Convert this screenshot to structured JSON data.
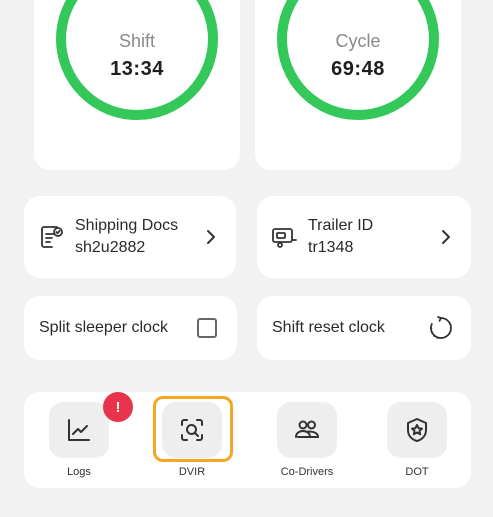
{
  "timers": {
    "shift": {
      "label": "Shift",
      "value": "13:34"
    },
    "cycle": {
      "label": "Cycle",
      "value": "69:48"
    }
  },
  "info": {
    "shipping_docs": {
      "title": "Shipping Docs",
      "value": "sh2u2882",
      "icon": "document-check-icon"
    },
    "trailer": {
      "title": "Trailer ID",
      "value": "tr1348",
      "icon": "trailer-icon"
    }
  },
  "toggles": {
    "split_sleeper": {
      "label": "Split sleeper clock",
      "checked": false
    },
    "shift_reset": {
      "label": "Shift reset clock",
      "icon": "reset-clock-icon"
    }
  },
  "nav": {
    "logs": {
      "label": "Logs",
      "icon": "chart-line-icon",
      "badge": "!"
    },
    "dvir": {
      "label": "DVIR",
      "icon": "inspection-scan-icon"
    },
    "codrivers": {
      "label": "Co-Drivers",
      "icon": "users-icon"
    },
    "dot": {
      "label": "DOT",
      "icon": "shield-star-icon"
    }
  },
  "colors": {
    "ring": "#34c759",
    "badge": "#e8344a",
    "highlight": "#f5a623",
    "background": "#f2f2f2",
    "card": "#ffffff"
  }
}
